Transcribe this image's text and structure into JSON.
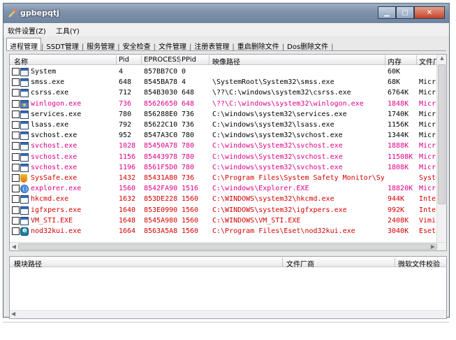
{
  "window": {
    "title": "gpbepqtj",
    "min_label": "▁",
    "max_label": "▢",
    "close_label": "✕"
  },
  "menu": [
    "软件设置(Z)",
    "工具(Y)"
  ],
  "tabs": [
    "进程管理",
    "SSDT管理",
    "服务管理",
    "安全检查",
    "文件管理",
    "注册表管理",
    "重启删除文件",
    "Dos删除文件"
  ],
  "columns": [
    "名称",
    "Pid",
    "EPROCESS",
    "PPid",
    "映像路径",
    "内存",
    "文件厂"
  ],
  "processes": [
    {
      "name": "System",
      "pid": "4",
      "eprocess": "857BB7C0",
      "ppid": "0",
      "path": "",
      "mem": "60K",
      "vendor": "",
      "color": "black",
      "icon": "sys"
    },
    {
      "name": "smss.exe",
      "pid": "648",
      "eprocess": "8545BA78",
      "ppid": "4",
      "path": "\\SystemRoot\\System32\\smss.exe",
      "mem": "68K",
      "vendor": "Micr",
      "color": "black",
      "icon": "app"
    },
    {
      "name": "csrss.exe",
      "pid": "712",
      "eprocess": "854B3030",
      "ppid": "648",
      "path": "\\??\\C:\\windows\\system32\\csrss.exe",
      "mem": "6764K",
      "vendor": "Micr",
      "color": "black",
      "icon": "app"
    },
    {
      "name": "winlogon.exe",
      "pid": "736",
      "eprocess": "85626650",
      "ppid": "648",
      "path": "\\??\\C:\\windows\\system32\\winlogon.exe",
      "mem": "1848K",
      "vendor": "Micr",
      "color": "pink",
      "icon": "win"
    },
    {
      "name": "services.exe",
      "pid": "780",
      "eprocess": "856288E0",
      "ppid": "736",
      "path": "C:\\windows\\system32\\services.exe",
      "mem": "1740K",
      "vendor": "Micr",
      "color": "black",
      "icon": "app"
    },
    {
      "name": "lsass.exe",
      "pid": "792",
      "eprocess": "85622C10",
      "ppid": "736",
      "path": "C:\\windows\\system32\\lsass.exe",
      "mem": "1156K",
      "vendor": "Micr",
      "color": "black",
      "icon": "app"
    },
    {
      "name": "svchost.exe",
      "pid": "952",
      "eprocess": "8547A3C0",
      "ppid": "780",
      "path": "C:\\windows\\system32\\svchost.exe",
      "mem": "1344K",
      "vendor": "Micr",
      "color": "black",
      "icon": "app"
    },
    {
      "name": "svchost.exe",
      "pid": "1028",
      "eprocess": "85450A78",
      "ppid": "780",
      "path": "C:\\windows\\System32\\svchost.exe",
      "mem": "1888K",
      "vendor": "Micr",
      "color": "pink",
      "icon": "app"
    },
    {
      "name": "svchost.exe",
      "pid": "1156",
      "eprocess": "85443978",
      "ppid": "780",
      "path": "C:\\windows\\System32\\svchost.exe",
      "mem": "11508K",
      "vendor": "Micr",
      "color": "pink",
      "icon": "app"
    },
    {
      "name": "svchost.exe",
      "pid": "1196",
      "eprocess": "8561F5D0",
      "ppid": "780",
      "path": "C:\\windows\\system32\\svchost.exe",
      "mem": "1808K",
      "vendor": "Micr",
      "color": "pink",
      "icon": "app"
    },
    {
      "name": "SysSafe.exe",
      "pid": "1432",
      "eprocess": "85431A80",
      "ppid": "736",
      "path": "C:\\Program Files\\System Safety Monitor\\Sy...",
      "mem": "",
      "vendor": "Syste",
      "color": "red",
      "icon": "shield"
    },
    {
      "name": "explorer.exe",
      "pid": "1560",
      "eprocess": "8542FA90",
      "ppid": "1516",
      "path": "C:\\windows\\Explorer.EXE",
      "mem": "18820K",
      "vendor": "Micr",
      "color": "pink",
      "icon": "globe"
    },
    {
      "name": "hkcmd.exe",
      "pid": "1632",
      "eprocess": "853DE228",
      "ppid": "1560",
      "path": "C:\\WINDOWS\\system32\\hkcmd.exe",
      "mem": "944K",
      "vendor": "Intel",
      "color": "red",
      "icon": "app"
    },
    {
      "name": "igfxpers.exe",
      "pid": "1640",
      "eprocess": "853E0990",
      "ppid": "1560",
      "path": "C:\\WINDOWS\\system32\\igfxpers.exe",
      "mem": "992K",
      "vendor": "Intel",
      "color": "red",
      "icon": "app"
    },
    {
      "name": "VM_STI.EXE",
      "pid": "1648",
      "eprocess": "8545A980",
      "ppid": "1560",
      "path": "C:\\WINDOWS\\VM_STI.EXE",
      "mem": "2408K",
      "vendor": "Vimic",
      "color": "red",
      "icon": "app"
    },
    {
      "name": "nod32kui.exe",
      "pid": "1664",
      "eprocess": "8563A5A8",
      "ppid": "1560",
      "path": "C:\\Program Files\\Eset\\nod32kui.exe",
      "mem": "3040K",
      "vendor": "Eset",
      "color": "red",
      "icon": "eset"
    }
  ],
  "module_columns": [
    "模块路径",
    "文件厂商",
    "微软文件校验"
  ]
}
